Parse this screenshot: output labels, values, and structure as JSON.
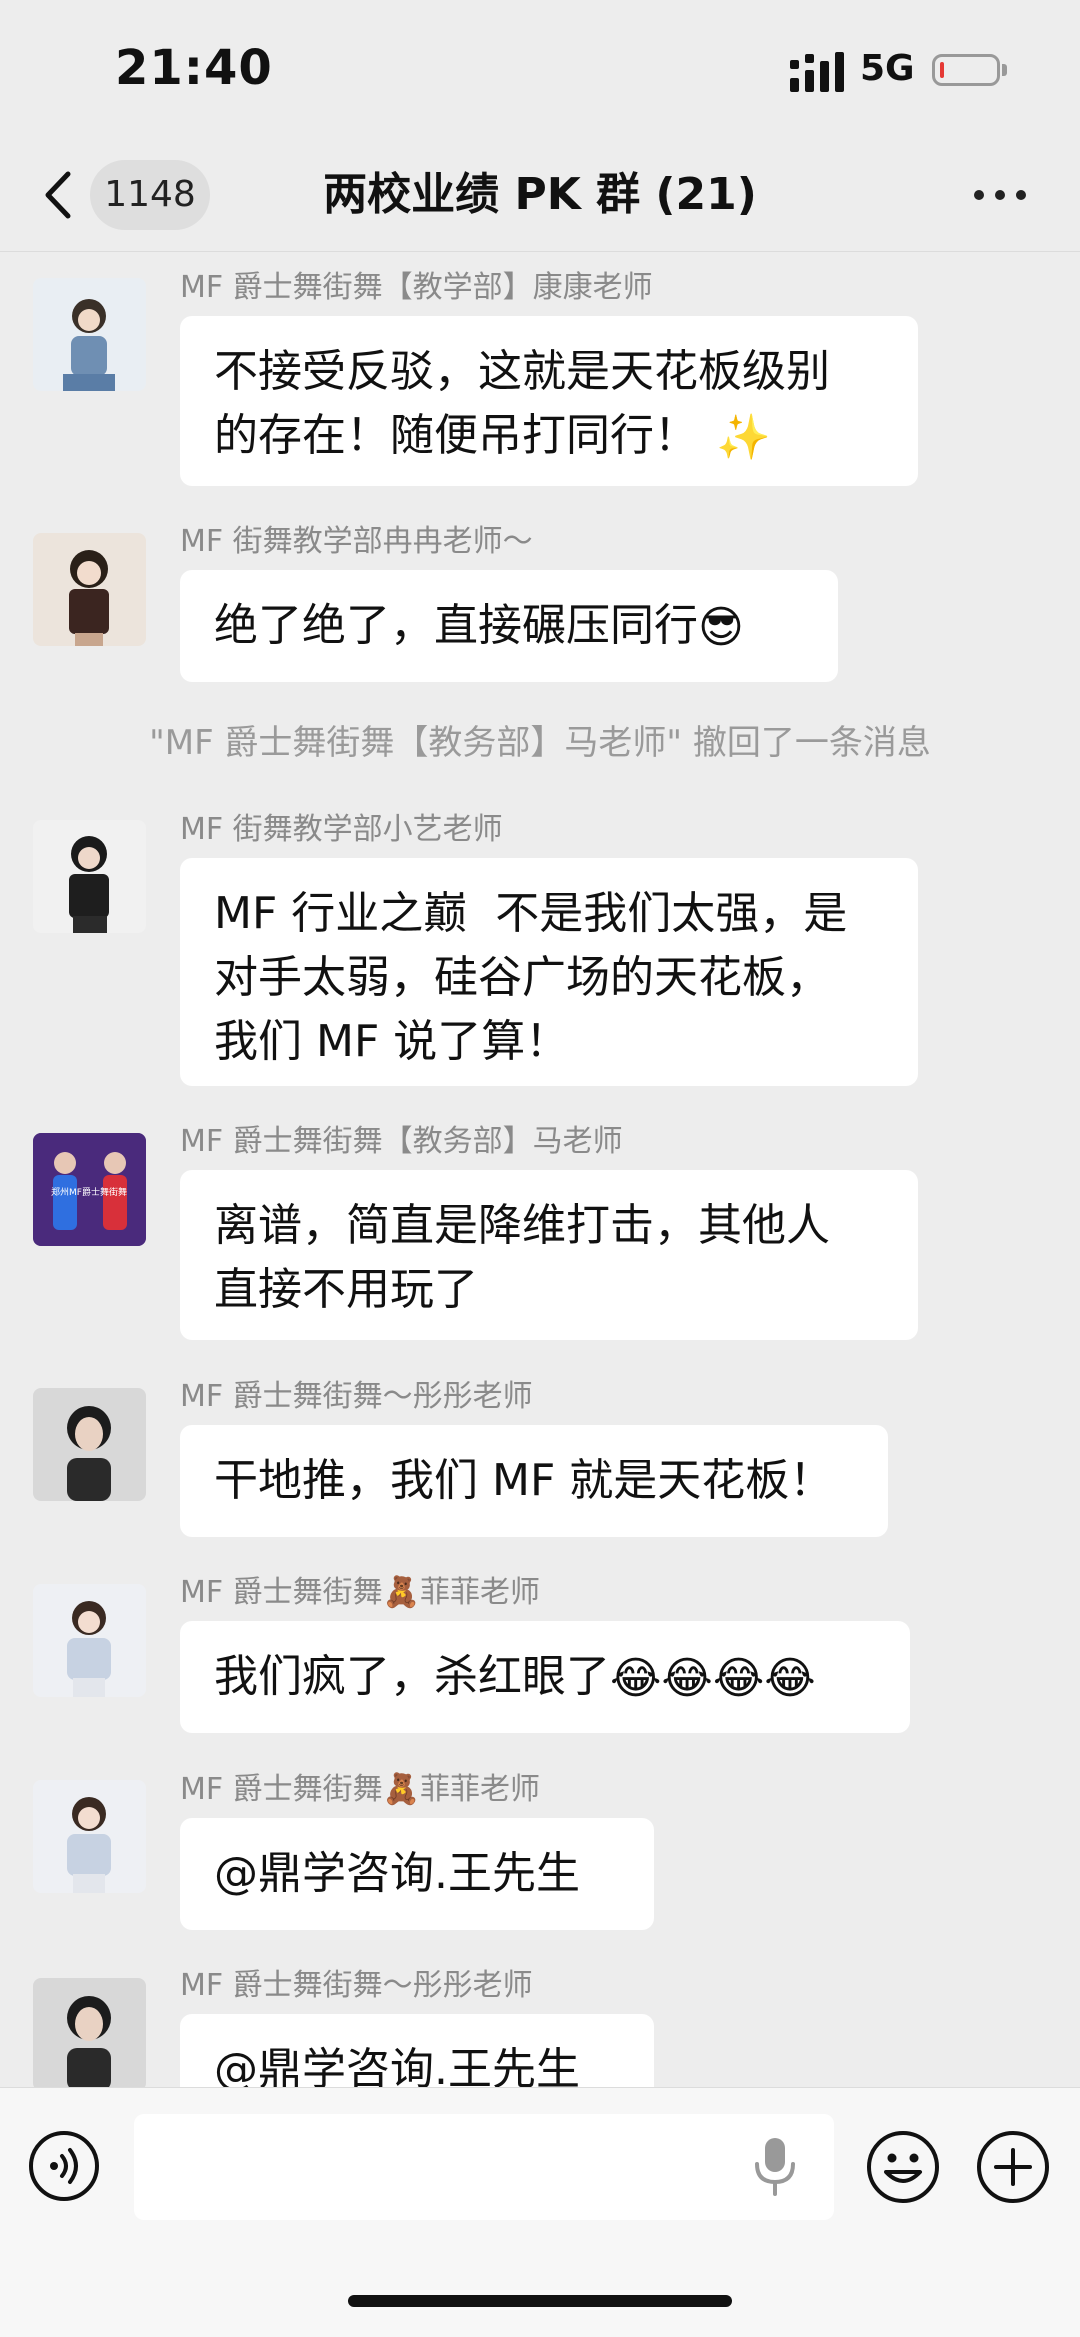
{
  "status_bar": {
    "time": "21:40",
    "network": "5G"
  },
  "nav": {
    "unread_count": "1148",
    "title": "两校业绩 PK 群 (21)"
  },
  "messages": [
    {
      "sender": "MF 爵士舞街舞【教学部】康康老师",
      "text": "不接受反驳，这就是天花板级别\n的存在！随便吊打同行！",
      "emoji": "✨"
    },
    {
      "sender": "MF 街舞教学部冉冉老师～",
      "text": "绝了绝了，直接碾压同行",
      "emoji": "😎"
    },
    {
      "sender": "MF 街舞教学部小艺老师",
      "text": "MF 行业之巅  不是我们太强，是\n对手太弱，硅谷广场的天花板，\n我们 MF 说了算！",
      "emoji": ""
    },
    {
      "sender": "MF 爵士舞街舞【教务部】马老师",
      "text": "离谱，简直是降维打击，其他人\n直接不用玩了",
      "emoji": "",
      "avatar_text": "郑州MF爵士舞街舞"
    },
    {
      "sender": "MF 爵士舞街舞～彤彤老师",
      "text": "干地推，我们 MF 就是天花板！",
      "emoji": ""
    },
    {
      "sender": "MF 爵士舞街舞🧸菲菲老师",
      "text": "我们疯了，杀红眼了",
      "emoji": "😂😂😂😂"
    },
    {
      "sender": "MF 爵士舞街舞🧸菲菲老师",
      "text": "@鼎学咨询.王先生",
      "emoji": ""
    },
    {
      "sender": "MF 爵士舞街舞～彤彤老师",
      "text": "@鼎学咨询.王先生",
      "emoji": ""
    }
  ],
  "system_notice": "\"MF 爵士舞街舞【教务部】马老师\" 撤回了一条消息",
  "input": {
    "placeholder": ""
  },
  "icons": {
    "back": "chevron-left-icon",
    "more": "more-dots-icon",
    "voice": "voice-icon",
    "mic": "microphone-icon",
    "emoji": "emoji-smile-icon",
    "plus": "plus-circle-icon"
  },
  "colors": {
    "background": "#ededed",
    "bubble": "#ffffff",
    "sender_text": "#8a8a8a",
    "badge": "#dedede"
  }
}
